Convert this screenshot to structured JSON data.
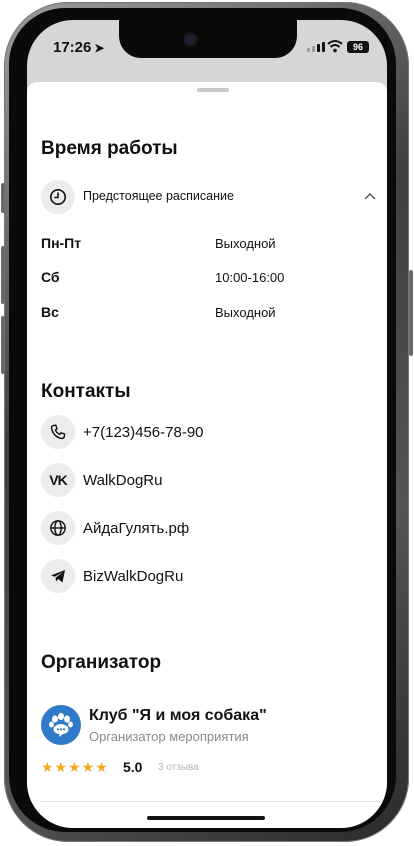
{
  "status": {
    "time": "17:26",
    "battery": "96"
  },
  "hours": {
    "title": "Время работы",
    "toggle_label": "Предстоящее расписание",
    "rows": [
      {
        "day": "Пн-Пт",
        "value": "Выходной"
      },
      {
        "day": "Сб",
        "value": "10:00-16:00"
      },
      {
        "day": "Вс",
        "value": "Выходной"
      }
    ]
  },
  "contacts": {
    "title": "Контакты",
    "items": [
      {
        "icon": "phone-icon",
        "text": "+7(123)456-78-90"
      },
      {
        "icon": "vk-icon",
        "text": "WalkDogRu"
      },
      {
        "icon": "globe-icon",
        "text": "АйдаГулять.рф"
      },
      {
        "icon": "telegram-icon",
        "text": "BizWalkDogRu"
      }
    ]
  },
  "organizer": {
    "title": "Организатор",
    "name": "Клуб \"Я и моя собака\"",
    "subtitle": "Организатор мероприятия",
    "stars": "★★★★★",
    "rating": "5.0",
    "reviews": "3 отзыва"
  },
  "colors": {
    "accent": "#2f79c9",
    "star": "#f5a623"
  }
}
